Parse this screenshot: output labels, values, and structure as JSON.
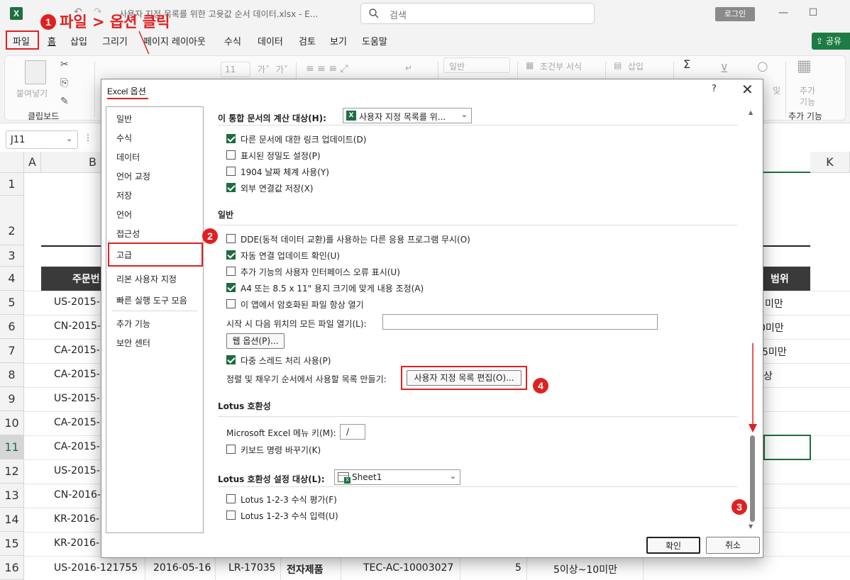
{
  "titlebar": {
    "title": "사용자 지정 목록를 위한 고윳값 순서 데이터.xlsx  -  E...",
    "search_placeholder": "검색",
    "login": "로그인",
    "minimize": "—",
    "restore": "☐"
  },
  "menu": {
    "items": [
      "파일",
      "홈",
      "삽입",
      "그리기",
      "페이지 레이아웃",
      "수식",
      "데이터",
      "검토",
      "보기",
      "도움말"
    ],
    "share": "공유"
  },
  "annotation": {
    "step1_text": "파일 > 옵션 클릭",
    "n1": "1",
    "n2": "2",
    "n3": "3",
    "n4": "4"
  },
  "ribbon": {
    "paste": "붙여넣기",
    "clipboard": "클립보드",
    "font_size": "11",
    "number_format": "일반",
    "cond_format": "조건부 서식",
    "insert": "삽입",
    "addins": "추가 기능",
    "addins2": "추가",
    "addins3": "기능",
    "addins_group": "추가 기능",
    "find": "및"
  },
  "formula_bar": {
    "namebox": "J11"
  },
  "sheet": {
    "columns": [
      "A",
      "B",
      "K"
    ],
    "rows": [
      "1",
      "2",
      "3",
      "4",
      "5",
      "6",
      "7",
      "8",
      "9",
      "10",
      "11",
      "12",
      "13",
      "14",
      "15",
      "16"
    ],
    "b_cells": [
      "주문번",
      "US-2015-",
      "CN-2015-",
      "CA-2015-",
      "CA-2015-",
      "US-2015-",
      "CA-2015-",
      "CA-2015-",
      "US-2015-",
      "CN-2016-",
      "KR-2016-",
      "KR-2016-"
    ],
    "right_cells": [
      "범위",
      "미만",
      "0미만",
      "5미만",
      "상"
    ],
    "row16": [
      "US-2016-121755",
      "2016-05-16",
      "LR-17035",
      "전자제품",
      "TEC-AC-10003027",
      "5",
      "5이상~10미만"
    ]
  },
  "dialog": {
    "title": "Excel 옵션",
    "help": "?",
    "close": "✕",
    "categories": [
      "일반",
      "수식",
      "데이터",
      "언어 교정",
      "저장",
      "언어",
      "접근성",
      "고급",
      "리본 사용자 지정",
      "빠른 실행 도구 모음",
      "추가 기능",
      "보안 센터"
    ],
    "calc_target_label": "이 통합 문서의 계산 대상(H):",
    "calc_target_value": "사용자 지정 목록를 위...",
    "opts_calc": [
      {
        "label": "다른 문서에 대한 링크 업데이트(D)",
        "checked": true
      },
      {
        "label": "표시된 정밀도 설정(P)",
        "checked": false
      },
      {
        "label": "1904 날짜 체계 사용(Y)",
        "checked": false
      },
      {
        "label": "외부 연결값 저장(X)",
        "checked": true
      }
    ],
    "general_title": "일반",
    "opts_general": [
      {
        "label": "DDE(동적 데이터 교환)를 사용하는 다른 응용 프로그램 무시(O)",
        "checked": false
      },
      {
        "label": "자동 연결 업데이트 확인(U)",
        "checked": true
      },
      {
        "label": "추가 기능의 사용자 인터페이스 오류 표시(U)",
        "checked": false
      },
      {
        "label": "A4 또는 8.5 x 11\" 용지 크기에 맞게 내용 조정(A)",
        "checked": true
      },
      {
        "label": "이 앱에서 암호화된 파일 항상 열기",
        "checked": false
      }
    ],
    "startup_label": "시작 시 다음 위치의 모든 파일 열기(L):",
    "web_options_btn": "웹 옵션(P)...",
    "multithread": {
      "label": "다중 스레드 처리 사용(P)",
      "checked": true
    },
    "custom_list_label": "정렬 및 채우기 순서에서 사용할 목록 만들기:",
    "custom_list_btn": "사용자 지정 목록 편집(O)...",
    "lotus_title": "Lotus 호환성",
    "menu_key_label": "Microsoft Excel 메뉴 키(M):",
    "menu_key_value": "/",
    "nav_keys": {
      "label": "키보드 명령 바꾸기(K)",
      "checked": false
    },
    "lotus_settings_label": "Lotus 호환성 설정 대상(L):",
    "lotus_settings_value": "Sheet1",
    "opts_lotus": [
      {
        "label": "Lotus 1-2-3 수식 평가(F)",
        "checked": false
      },
      {
        "label": "Lotus 1-2-3 수식 입력(U)",
        "checked": false
      }
    ],
    "ok": "확인",
    "cancel": "취소"
  },
  "colors": {
    "accent_red": "#e02020",
    "excel_green": "#1d6f42",
    "header_dark": "#3a3a3a"
  }
}
